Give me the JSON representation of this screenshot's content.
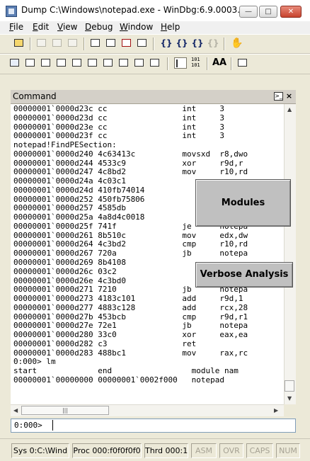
{
  "window": {
    "title": "Dump C:\\Windows\\notepad.exe - WinDbg:6.9.0003.113 ...",
    "minimize": "—",
    "maximize": "□",
    "close": "✕"
  },
  "menu": {
    "items": [
      {
        "accel": "F",
        "rest": "ile"
      },
      {
        "accel": "E",
        "rest": "dit"
      },
      {
        "accel": "V",
        "rest": "iew"
      },
      {
        "accel": "D",
        "rest": "ebug"
      },
      {
        "accel": "W",
        "rest": "indow"
      },
      {
        "accel": "H",
        "rest": "elp"
      }
    ]
  },
  "toolbar": {
    "source_mode_label": "101\n101",
    "font_label": "AA"
  },
  "command_pane": {
    "title": "Command",
    "lines": [
      "00000001`0000d23c cc                int     3",
      "00000001`0000d23d cc                int     3",
      "00000001`0000d23e cc                int     3",
      "00000001`0000d23f cc                int     3",
      "notepad!FindPESection:",
      "00000001`0000d240 4c63413c          movsxd  r8,dwo",
      "00000001`0000d244 4533c9            xor     r9d,r",
      "00000001`0000d247 4c8bd2            mov     r10,rd",
      "00000001`0000d24a 4c03c1",
      "00000001`0000d24d 410fb74014",
      "00000001`0000d252 450fb75806",
      "00000001`0000d257 4585db",
      "00000001`0000d25a 4a8d4c0018",
      "00000001`0000d25f 741f              je      notepa",
      "00000001`0000d261 8b510c            mov     edx,dw",
      "00000001`0000d264 4c3bd2            cmp     r10,rd",
      "00000001`0000d267 720a              jb      notepa",
      "00000001`0000d269 8b4108",
      "00000001`0000d26c 03c2",
      "00000001`0000d26e 4c3bd0",
      "00000001`0000d271 7210              jb      notepa",
      "00000001`0000d273 4183c101          add     r9d,1",
      "00000001`0000d277 4883c128          add     rcx,28",
      "00000001`0000d27b 453bcb            cmp     r9d,r1",
      "00000001`0000d27e 72e1              jb      notepa",
      "00000001`0000d280 33c0              xor     eax,ea",
      "00000001`0000d282 c3                ret",
      "00000001`0000d283 488bc1            mov     rax,rc",
      "0:000> lm",
      "start             end                 module nam",
      "00000001`00000000 00000001`0002f000   notepad"
    ],
    "prompt": "0:000>",
    "input_value": ""
  },
  "overlay_buttons": {
    "modules": "Modules",
    "verbose": "Verbose Analysis"
  },
  "statusbar": {
    "sys": "Sys 0:C:\\Wind",
    "proc": "Proc 000:f0f0f0f0",
    "thrd": "Thrd 000:1",
    "asm": "ASM",
    "ovr": "OVR",
    "caps": "CAPS",
    "num": "NUM"
  }
}
